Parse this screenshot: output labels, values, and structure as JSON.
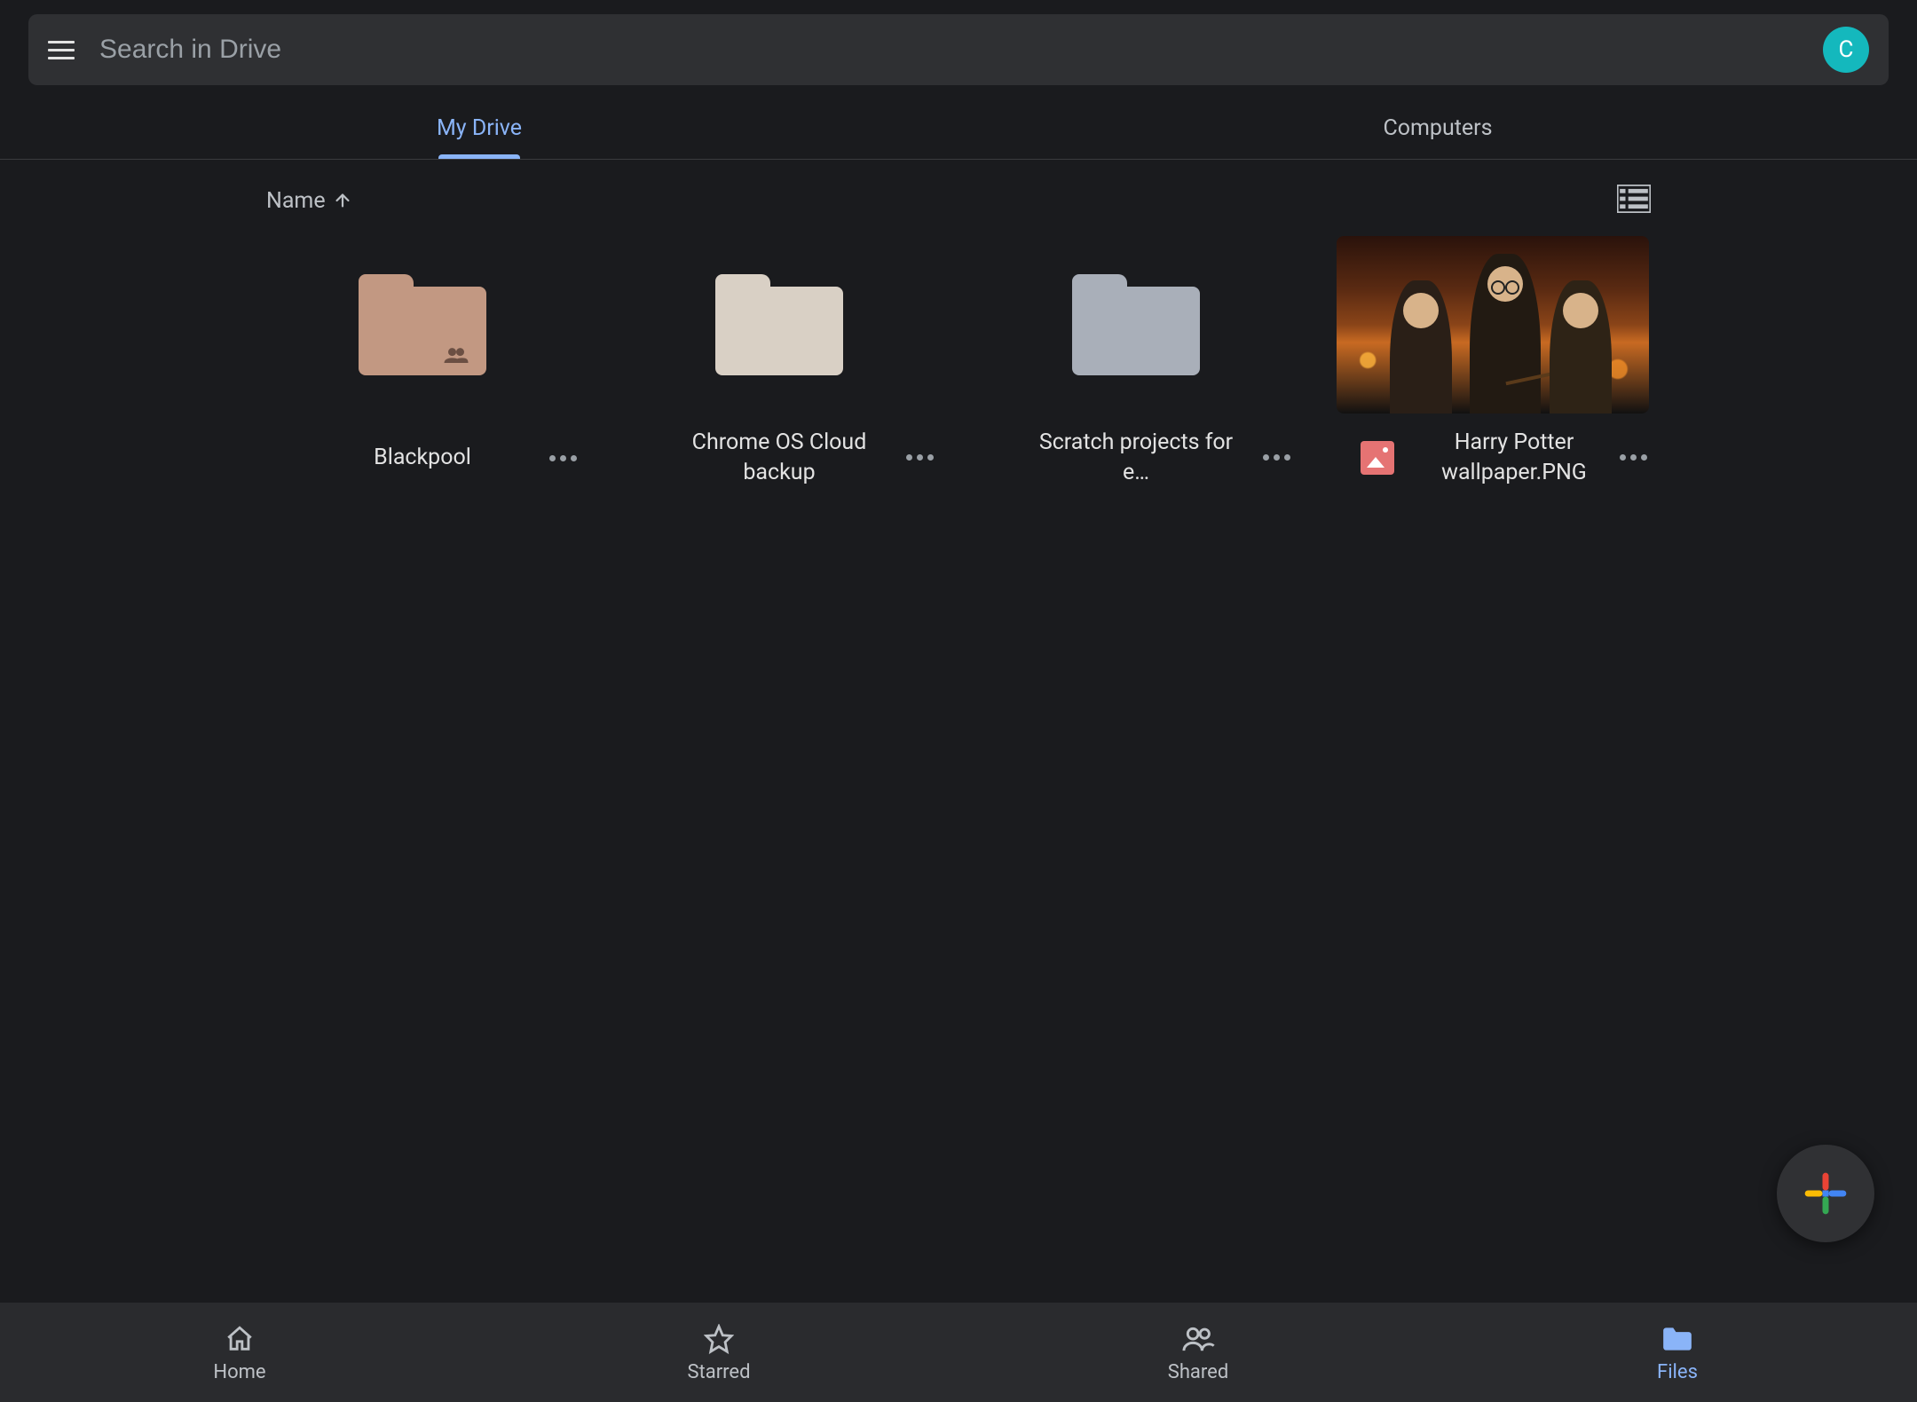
{
  "search": {
    "placeholder": "Search in Drive",
    "value": ""
  },
  "account": {
    "initial": "C"
  },
  "tabs": [
    {
      "id": "my-drive",
      "label": "My Drive",
      "active": true
    },
    {
      "id": "computers",
      "label": "Computers",
      "active": false
    }
  ],
  "sort": {
    "field": "Name",
    "direction": "asc"
  },
  "view_mode": "grid",
  "items": [
    {
      "type": "folder",
      "name": "Blackpool",
      "folder_color": "#c29882",
      "shared": true
    },
    {
      "type": "folder",
      "name": "Chrome OS Cloud backup",
      "folder_color": "#d9d0c5",
      "shared": false
    },
    {
      "type": "folder",
      "name": "Scratch projects for e…",
      "folder_color": "#a9afb9",
      "shared": false
    },
    {
      "type": "image",
      "name": "Harry Potter wallpaper.PNG",
      "icon": "image-icon"
    }
  ],
  "bottom_nav": [
    {
      "id": "home",
      "label": "Home",
      "active": false
    },
    {
      "id": "starred",
      "label": "Starred",
      "active": false
    },
    {
      "id": "shared",
      "label": "Shared",
      "active": false
    },
    {
      "id": "files",
      "label": "Files",
      "active": true
    }
  ],
  "fab": {
    "label": "Create"
  }
}
